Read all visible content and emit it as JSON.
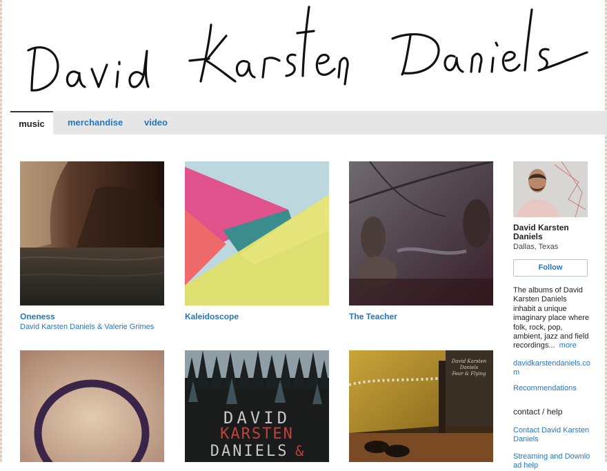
{
  "header": {
    "logo_text": "David Karsten Daniels"
  },
  "nav": {
    "tabs": [
      {
        "label": "music",
        "active": true
      },
      {
        "label": "merchandise",
        "active": false
      },
      {
        "label": "video",
        "active": false
      }
    ]
  },
  "albums": [
    {
      "title": "Oneness",
      "artist": "David Karsten Daniels & Valerie Grimes",
      "art": "cave-water"
    },
    {
      "title": "Kaleidoscope",
      "artist": "",
      "art": "geometric-triangles"
    },
    {
      "title": "The Teacher",
      "artist": "",
      "art": "forest-campfire"
    },
    {
      "title": "",
      "artist": "",
      "art": "ink-circle"
    },
    {
      "title": "",
      "artist": "",
      "art": "pine-forest",
      "art_text": [
        "DAVID",
        "KARSTEN",
        "DANIELS",
        "&"
      ]
    },
    {
      "title": "",
      "artist": "",
      "art": "blanket-and-shoes",
      "art_text": [
        "David Karsten Daniels",
        "Fear & Flying"
      ]
    }
  ],
  "sidebar": {
    "name": "David Karsten Daniels",
    "location": "Dallas, Texas",
    "follow_label": "Follow",
    "bio": "The albums of David Karsten Daniels inhabit a unique imaginary place where folk, rock, pop, ambient, jazz and field recordings...",
    "more_label": "more",
    "website": "davidkarstendaniels.com",
    "recommendations": "Recommendations",
    "contact_heading": "contact / help",
    "contact_link": "Contact David Karsten Daniels",
    "streaming_link": "Streaming and Download help"
  },
  "colors": {
    "link": "#1f77c8",
    "nav_bg": "#e6e6e6",
    "text": "#222222"
  }
}
